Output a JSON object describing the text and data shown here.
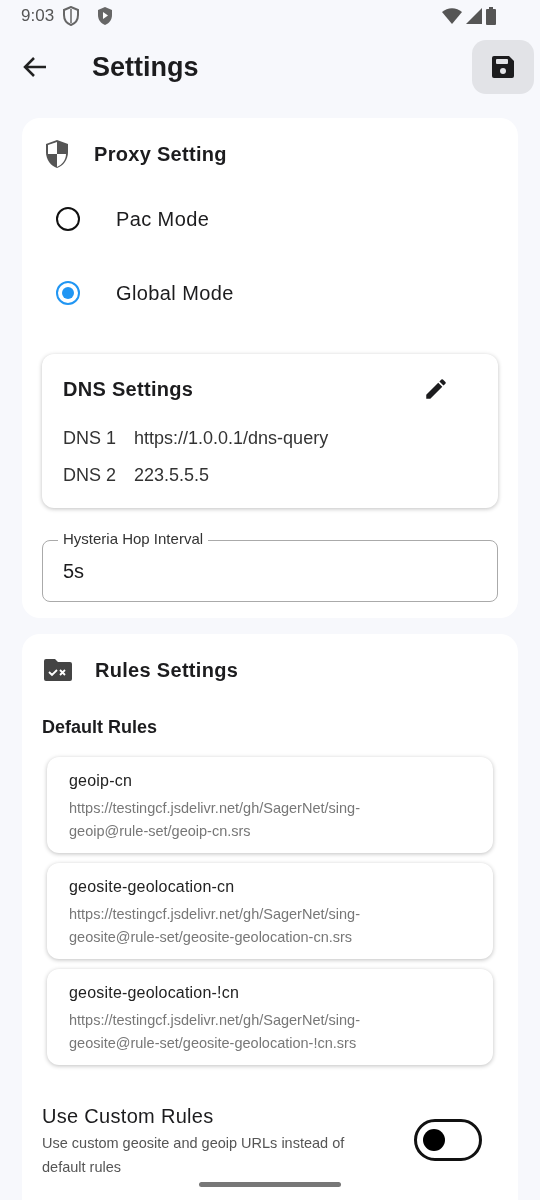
{
  "status_bar": {
    "time": "9:03"
  },
  "app_bar": {
    "title": "Settings"
  },
  "proxy": {
    "title": "Proxy Setting",
    "modes": [
      {
        "label": "Pac Mode",
        "selected": false
      },
      {
        "label": "Global Mode",
        "selected": true
      }
    ],
    "dns": {
      "title": "DNS Settings",
      "rows": [
        {
          "label": "DNS 1",
          "value": "https://1.0.0.1/dns-query"
        },
        {
          "label": "DNS 2",
          "value": "223.5.5.5"
        }
      ]
    },
    "hop_interval": {
      "label": "Hysteria Hop Interval",
      "value": "5s"
    }
  },
  "rules": {
    "title": "Rules Settings",
    "subtitle": "Default Rules",
    "items": [
      {
        "name": "geoip-cn",
        "url": "https://testingcf.jsdelivr.net/gh/SagerNet/sing-geoip@rule-set/geoip-cn.srs"
      },
      {
        "name": "geosite-geolocation-cn",
        "url": "https://testingcf.jsdelivr.net/gh/SagerNet/sing-geosite@rule-set/geosite-geolocation-cn.srs"
      },
      {
        "name": "geosite-geolocation-!cn",
        "url": "https://testingcf.jsdelivr.net/gh/SagerNet/sing-geosite@rule-set/geosite-geolocation-!cn.srs"
      }
    ],
    "custom": {
      "title": "Use Custom Rules",
      "description": "Use custom geosite and geoip URLs instead of default rules",
      "checked": false
    }
  }
}
